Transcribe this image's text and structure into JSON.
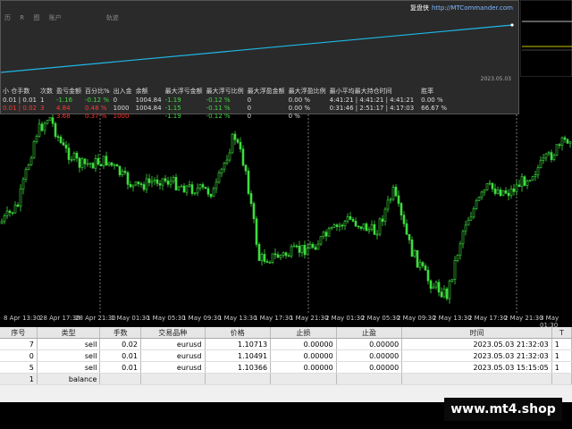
{
  "panel": {
    "tabs": [
      "历",
      "R",
      "图",
      "账户",
      "轨迹"
    ],
    "brand_cn": "复盘侠",
    "brand_url": "http://MTCommander.com",
    "date": "2023.05.03"
  },
  "stats": {
    "headers": [
      "小 仓手数",
      "次数",
      "盈亏金额",
      "百分比%",
      "出入金",
      "余额",
      "最大浮亏金额",
      "最大浮亏比例",
      "最大浮盈金额",
      "最大浮盈比例",
      "最小平均最大持仓时间",
      "",
      "胜率"
    ],
    "rows": [
      [
        "0.01 | 0.01",
        "1",
        "-1.16",
        "-0.12 %",
        "0",
        "1004.84",
        "-1.19",
        "-0.12 %",
        "0",
        "0.00 %",
        "4:41:21 | 4:41:21 | 4:41:21",
        "",
        "0.00 %"
      ],
      [
        "0.01 | 0.02",
        "3",
        "4.84",
        "0.48 %",
        "1000",
        "1004.84",
        "-1.15",
        "-0.11 %",
        "0",
        "0.00 %",
        "0:31:46 | 2:51:17 | 4:17:03",
        "",
        "66.67 %"
      ],
      [
        "",
        "",
        "3.68",
        "0.37 %",
        "1000",
        "",
        "-1.19",
        "-0.12 %",
        "0",
        "0 %",
        "",
        "",
        ""
      ]
    ]
  },
  "xaxis": {
    "labels": [
      "8 Apr 13:30",
      "28 Apr 17:30",
      "28 Apr 21:30",
      "1 May 01:30",
      "1 May 05:30",
      "1 May 09:30",
      "1 May 13:30",
      "1 May 17:30",
      "1 May 21:30",
      "2 May 01:30",
      "2 May 05:30",
      "2 May 09:30",
      "2 May 13:30",
      "2 May 17:30",
      "2 May 21:30",
      "3 May 01:30"
    ]
  },
  "orders": {
    "headers": [
      "序号",
      "类型",
      "手数",
      "交易品种",
      "价格",
      "止损",
      "止盈",
      "时间",
      "T"
    ],
    "rows": [
      [
        "7",
        "sell",
        "0.02",
        "eurusd",
        "1.10713",
        "0.00000",
        "0.00000",
        "2023.05.03 21:32:03",
        "1"
      ],
      [
        "0",
        "sell",
        "0.01",
        "eurusd",
        "1.10491",
        "0.00000",
        "0.00000",
        "2023.05.03 21:32:03",
        "1"
      ],
      [
        "5",
        "sell",
        "0.01",
        "eurusd",
        "1.10366",
        "0.00000",
        "0.00000",
        "2023.05.03 15:15:05",
        "1"
      ]
    ],
    "balance_row": [
      "1",
      "balance"
    ]
  },
  "watermark": "www.mt4.shop",
  "colors": {
    "candle": "#3fdc3f",
    "equity": "#1fb8e6",
    "bg": "#000000"
  }
}
